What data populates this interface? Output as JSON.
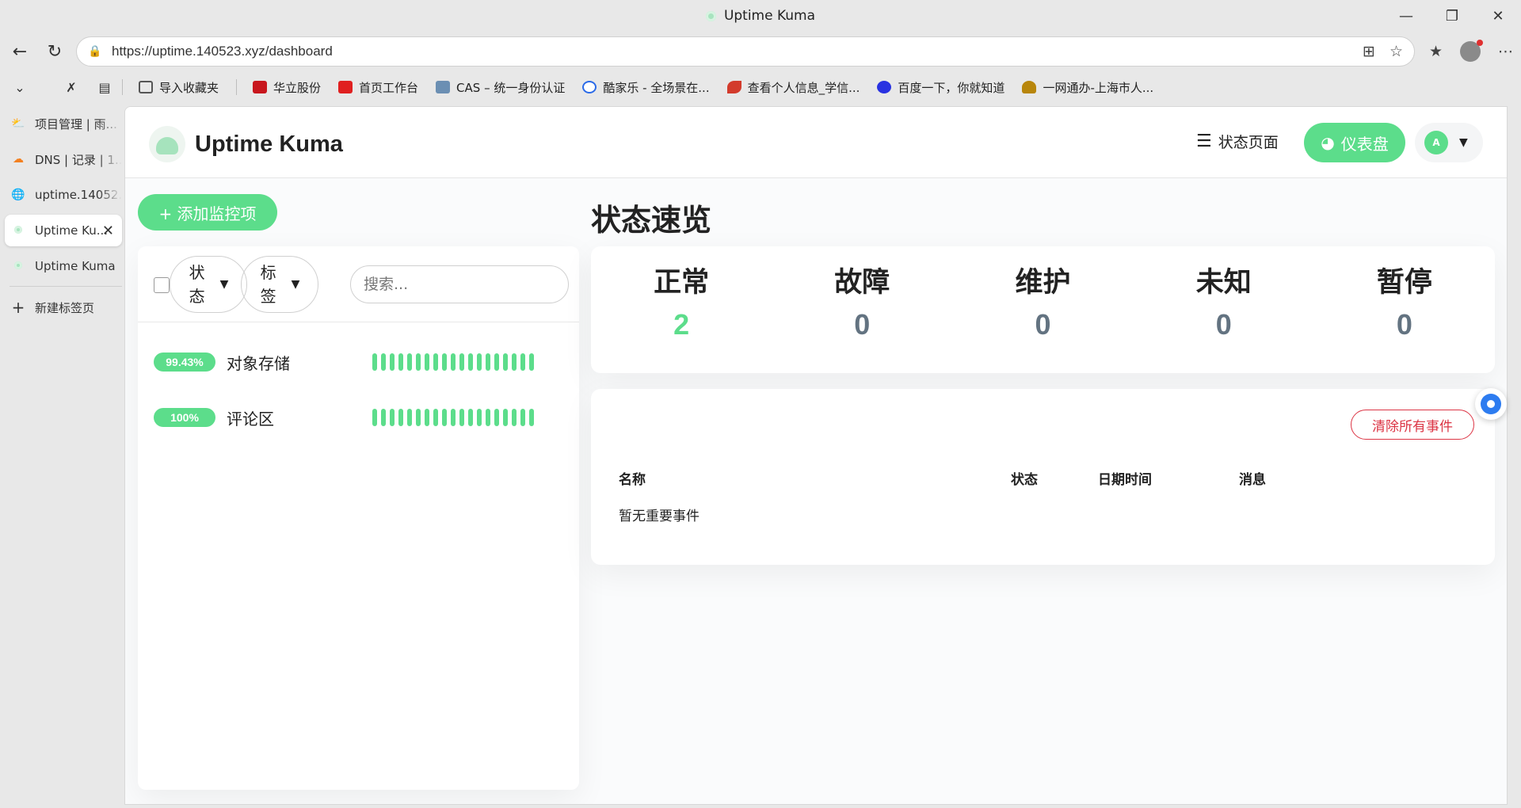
{
  "browser": {
    "window_title": "Uptime Kuma",
    "url": "https://uptime.140523.xyz/dashboard",
    "bookmarks": [
      {
        "label": "导入收藏夹",
        "icon": "import-icon",
        "color": "#555555"
      },
      {
        "label": "华立股份",
        "icon": "huali-icon",
        "color": "#c8161d"
      },
      {
        "label": "首页工作台",
        "icon": "workbench-icon",
        "color": "#e02020"
      },
      {
        "label": "CAS – 统一身份认证",
        "icon": "cas-icon",
        "color": "#6b8fb3"
      },
      {
        "label": "酷家乐 - 全场景在...",
        "icon": "kujiale-icon",
        "color": "#2a6ae8"
      },
      {
        "label": "查看个人信息_学信...",
        "icon": "xuexin-icon",
        "color": "#d33b2c"
      },
      {
        "label": "百度一下，你就知道",
        "icon": "baidu-icon",
        "color": "#2932e1"
      },
      {
        "label": "一网通办-上海市人...",
        "icon": "shanghai-icon",
        "color": "#b8860b"
      }
    ],
    "tabs": [
      {
        "label": "项目管理 | 雨...",
        "icon": "weather-icon",
        "active": false
      },
      {
        "label": "DNS | 记录 | 1...",
        "icon": "cloudflare-icon",
        "active": false
      },
      {
        "label": "uptime.14052...",
        "icon": "globe-icon",
        "active": false
      },
      {
        "label": "Uptime Ku...",
        "icon": "uptime-kuma-icon",
        "active": true
      },
      {
        "label": "Uptime Kuma",
        "icon": "uptime-kuma-icon",
        "active": false
      }
    ],
    "new_tab_label": "新建标签页"
  },
  "app": {
    "brand": "Uptime Kuma",
    "nav_status_page": "状态页面",
    "nav_dashboard": "仪表盘",
    "user_initial": "A",
    "add_monitor_label": "+ 添加监控项",
    "filters": {
      "status_label": "状态",
      "tags_label": "标签",
      "search_placeholder": "搜索..."
    },
    "monitors": [
      {
        "uptime": "99.43%",
        "name": "对象存储",
        "beats": 19
      },
      {
        "uptime": "100%",
        "name": "评论区",
        "beats": 19
      }
    ],
    "page_title": "状态速览",
    "stats": [
      {
        "label": "正常",
        "value": "2",
        "color": "#5cdd8b"
      },
      {
        "label": "故障",
        "value": "0",
        "color": "#637381"
      },
      {
        "label": "维护",
        "value": "0",
        "color": "#637381"
      },
      {
        "label": "未知",
        "value": "0",
        "color": "#637381"
      },
      {
        "label": "暂停",
        "value": "0",
        "color": "#637381"
      }
    ],
    "events": {
      "clear_label": "清除所有事件",
      "columns": [
        "名称",
        "状态",
        "日期时间",
        "消息"
      ],
      "empty_message": "暂无重要事件"
    }
  },
  "colors": {
    "accent": "#5cdd8b",
    "danger": "#dc3545"
  }
}
